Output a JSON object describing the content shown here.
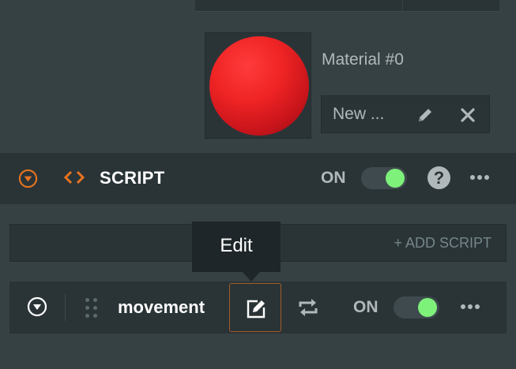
{
  "material": {
    "name": "Material #0",
    "asset_value": "New ..."
  },
  "script_component": {
    "title": "SCRIPT",
    "toggle_label": "ON",
    "enabled": true,
    "help_glyph": "?",
    "add_script_label": "+ ADD SCRIPT"
  },
  "tooltip": {
    "text": "Edit"
  },
  "script_entry": {
    "name": "movement",
    "toggle_label": "ON",
    "enabled": true
  },
  "colors": {
    "accent_orange": "#e8731f",
    "toggle_on": "#7ef17b",
    "panel_dark": "#2a3437",
    "background": "#364144"
  },
  "icons": [
    "collapse-icon",
    "code-icon",
    "help-icon",
    "more-icon",
    "pencil-icon",
    "close-icon",
    "drag-handle-icon",
    "edit-icon",
    "swap-icon",
    "material-preview"
  ]
}
